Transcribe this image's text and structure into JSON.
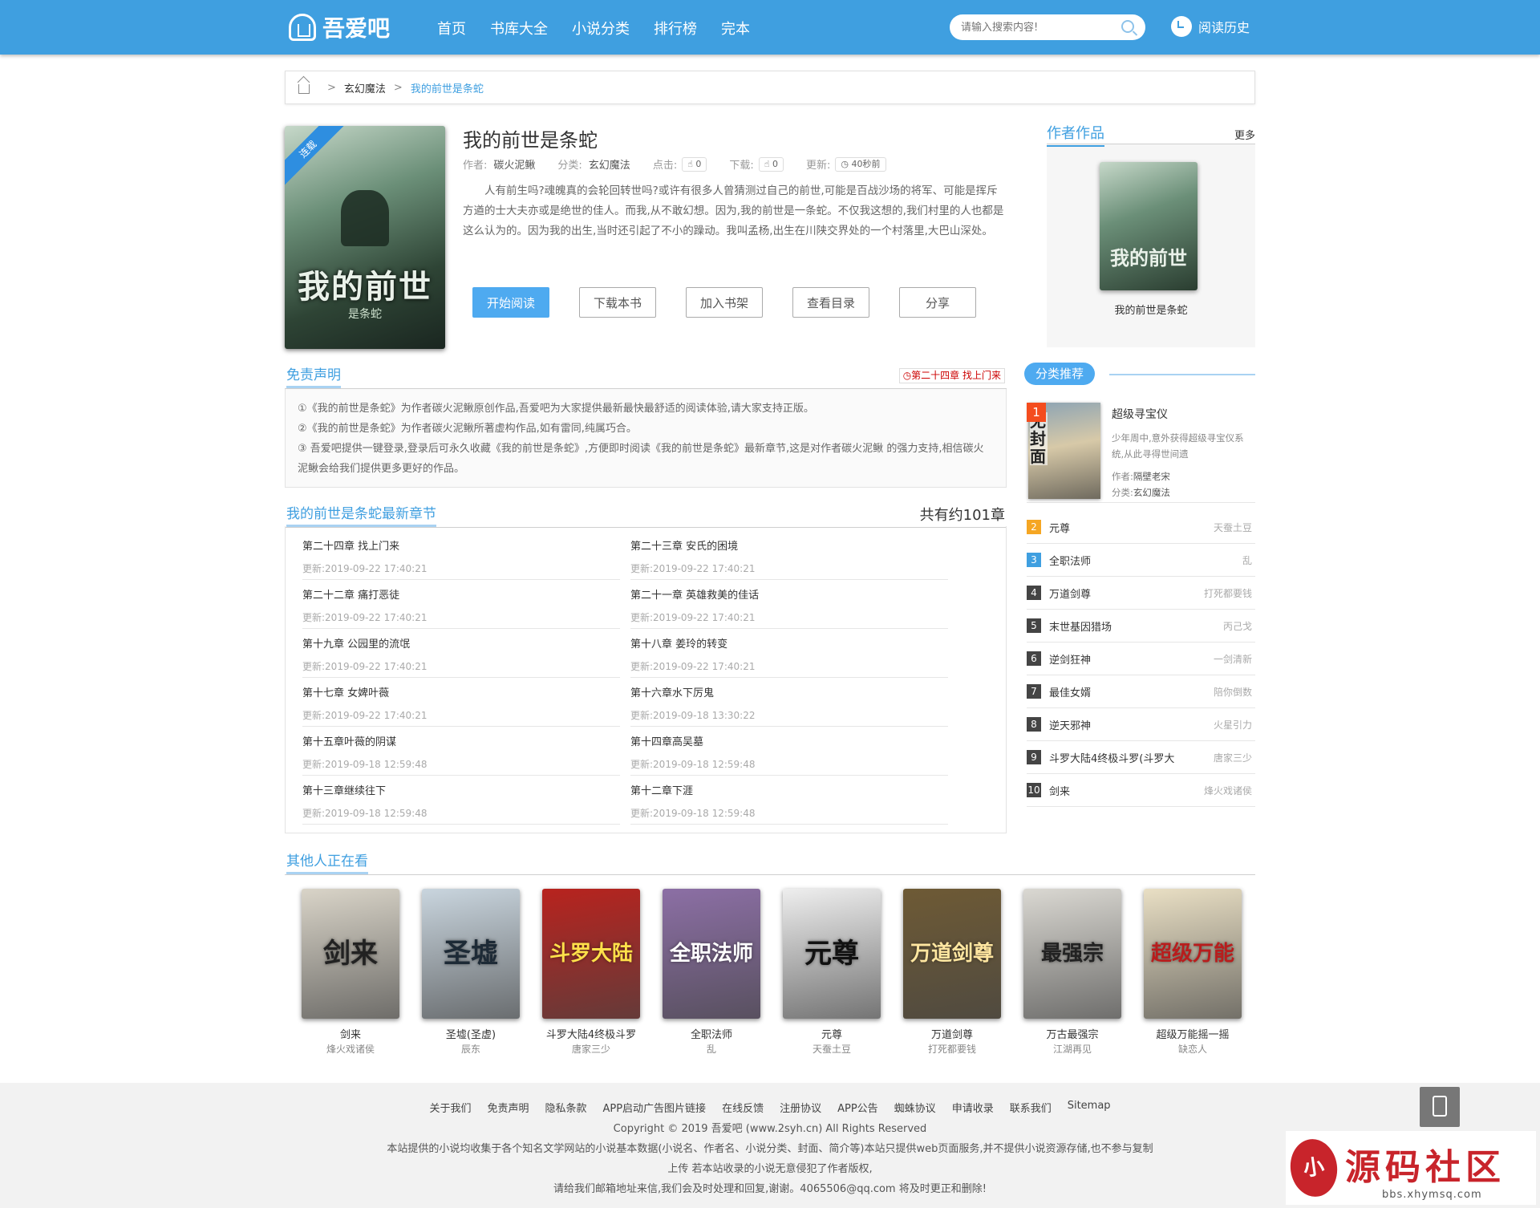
{
  "header": {
    "logo": "吾爱吧",
    "nav": [
      "首页",
      "书库大全",
      "小说分类",
      "排行榜",
      "完本"
    ],
    "search_placeholder": "请输入搜索内容!",
    "history": "阅读历史"
  },
  "breadcrumb": {
    "cat": "玄幻魔法",
    "current": "我的前世是条蛇"
  },
  "book": {
    "title": "我的前世是条蛇",
    "ribbon": "连载",
    "cover_title": "我的前世",
    "cover_sub": "是条蛇",
    "meta": {
      "author_l": "作者:",
      "author": "碳火泥鳅",
      "cat_l": "分类:",
      "cat": "玄幻魔法",
      "click_l": "点击:",
      "click": "0",
      "down_l": "下载:",
      "down": "0",
      "upd_l": "更新:",
      "upd": "40秒前"
    },
    "intro": "人有前生吗?魂魄真的会轮回转世吗?或许有很多人曾猜测过自己的前世,可能是百战沙场的将军、可能是挥斥方遒的士大夫亦或是绝世的佳人。而我,从不敢幻想。因为,我的前世是一条蛇。不仅我这想的,我们村里的人也都是这么认为的。因为我的出生,当时还引起了不小的躁动。我叫孟杨,出生在川陕交界处的一个村落里,大巴山深处。",
    "buttons": [
      "开始阅读",
      "下载本书",
      "加入书架",
      "查看目录",
      "分享"
    ]
  },
  "author_works": {
    "title": "作者作品",
    "more": "更多",
    "cover_title": "我的前世",
    "name": "我的前世是条蛇"
  },
  "disclaimer": {
    "title": "免责声明",
    "tag": "第二十四章 找上门来",
    "lines": [
      "①《我的前世是条蛇》为作者碳火泥鳅原创作品,吾爱吧为大家提供最新最快最舒适的阅读体验,请大家支持正版。",
      "②《我的前世是条蛇》为作者碳火泥鳅所著虚构作品,如有雷同,纯属巧合。",
      "③ 吾爱吧提供一键登录,登录后可永久收藏《我的前世是条蛇》,方便即时阅读《我的前世是条蛇》最新章节,这是对作者碳火泥鳅 的强力支持,相信碳火泥鳅会给我们提供更多更好的作品。"
    ]
  },
  "chapters": {
    "title": "我的前世是条蛇最新章节",
    "count": "共有约101章",
    "items": [
      {
        "name": "第二十四章 找上门来",
        "date": "更新:2019-09-22 17:40:21"
      },
      {
        "name": "第二十三章 安氏的困境",
        "date": "更新:2019-09-22 17:40:21"
      },
      {
        "name": "第二十二章 痛打恶徒",
        "date": "更新:2019-09-22 17:40:21"
      },
      {
        "name": "第二十一章 英雄救美的佳话",
        "date": "更新:2019-09-22 17:40:21"
      },
      {
        "name": "第十九章 公园里的流氓",
        "date": "更新:2019-09-22 17:40:21"
      },
      {
        "name": "第十八章 姜玲的转变",
        "date": "更新:2019-09-22 17:40:21"
      },
      {
        "name": "第十七章 女婢叶薇",
        "date": "更新:2019-09-22 17:40:21"
      },
      {
        "name": "第十六章水下厉鬼",
        "date": "更新:2019-09-18 13:30:22"
      },
      {
        "name": "第十五章叶薇的阴谋",
        "date": "更新:2019-09-18 12:59:48"
      },
      {
        "name": "第十四章高吴墓",
        "date": "更新:2019-09-18 12:59:48"
      },
      {
        "name": "第十三章继续往下",
        "date": "更新:2019-09-18 12:59:48"
      },
      {
        "name": "第十二章下涯",
        "date": "更新:2019-09-18 12:59:48"
      }
    ]
  },
  "recommend": {
    "title": "分类推荐",
    "top": {
      "num": "1",
      "nocover": "无封面",
      "name": "超级寻宝仪",
      "desc": "少年周中,意外获得超级寻宝仪系统,从此寻得世间遗",
      "author_l": "作者:",
      "author": "隔壁老宋",
      "cat_l": "分类:",
      "cat": "玄幻魔法"
    },
    "list": [
      {
        "num": "2",
        "name": "元尊",
        "author": "天蚕土豆",
        "color": "#f5a623"
      },
      {
        "num": "3",
        "name": "全职法师",
        "author": "乱",
        "color": "#3f9fe0"
      },
      {
        "num": "4",
        "name": "万道剑尊",
        "author": "打死都要钱",
        "color": "#444444"
      },
      {
        "num": "5",
        "name": "末世基因猎场",
        "author": "丙己戈",
        "color": "#444444"
      },
      {
        "num": "6",
        "name": "逆剑狂神",
        "author": "一剑清新",
        "color": "#444444"
      },
      {
        "num": "7",
        "name": "最佳女婿",
        "author": "陪你倒数",
        "color": "#444444"
      },
      {
        "num": "8",
        "name": "逆天邪神",
        "author": "火星引力",
        "color": "#444444"
      },
      {
        "num": "9",
        "name": "斗罗大陆4终极斗罗(斗罗大",
        "author": "唐家三少",
        "color": "#444444"
      },
      {
        "num": "10",
        "name": "剑来",
        "author": "烽火戏诸侯",
        "color": "#444444"
      }
    ]
  },
  "others": {
    "title": "其他人正在看",
    "books": [
      {
        "name": "剑来",
        "author": "烽火戏诸侯",
        "glyph": "剑来",
        "bg": "#d9d4c8",
        "fg": "#222222"
      },
      {
        "name": "圣墟(圣虚)",
        "author": "辰东",
        "glyph": "圣墟",
        "bg": "#c9d5de",
        "fg": "#1d2a36"
      },
      {
        "name": "斗罗大陆4终极斗罗",
        "author": "唐家三少",
        "glyph": "斗罗大陆",
        "bg": "#b8231e",
        "fg": "#ffe04a"
      },
      {
        "name": "全职法师",
        "author": "乱",
        "glyph": "全职法师",
        "bg": "#8c6fa5",
        "fg": "#ffffff"
      },
      {
        "name": "元尊",
        "author": "天蚕土豆",
        "glyph": "元尊",
        "bg": "#eeeeee",
        "fg": "#111111"
      },
      {
        "name": "万道剑尊",
        "author": "打死都要钱",
        "glyph": "万道剑尊",
        "bg": "#6e5a35",
        "fg": "#ffe6a0"
      },
      {
        "name": "万古最强宗",
        "author": "江湖再见",
        "glyph": "最强宗",
        "bg": "#dad8d2",
        "fg": "#222222"
      },
      {
        "name": "超级万能摇一摇",
        "author": "缺恋人",
        "glyph": "超级万能",
        "bg": "#e9dfc4",
        "fg": "#b81d1d"
      }
    ]
  },
  "footer": {
    "links": [
      "关于我们",
      "免责声明",
      "隐私条款",
      "APP启动广告图片链接",
      "在线反馈",
      "注册协议",
      "APP公告",
      "蜘蛛协议",
      "申请收录",
      "联系我们",
      "Sitemap"
    ],
    "copyright": "Copyright © 2019 吾爱吧 (www.2syh.cn) All Rights Reserved",
    "l1": "本站提供的小说均收集于各个知名文学网站的小说基本数据(小说名、作者名、小说分类、封面、简介等)本站只提供web页面服务,并不提供小说资源存储,也不参与复制",
    "l2": "上传 若本站收录的小说无意侵犯了作者版权,",
    "l3": "请给我们邮箱地址来信,我们会及时处理和回复,谢谢。4065506@qq.com 将及时更正和删除!"
  },
  "watermark": {
    "seal": "小",
    "big": "源码社区",
    "small": "bbs.xhymsq.com"
  }
}
